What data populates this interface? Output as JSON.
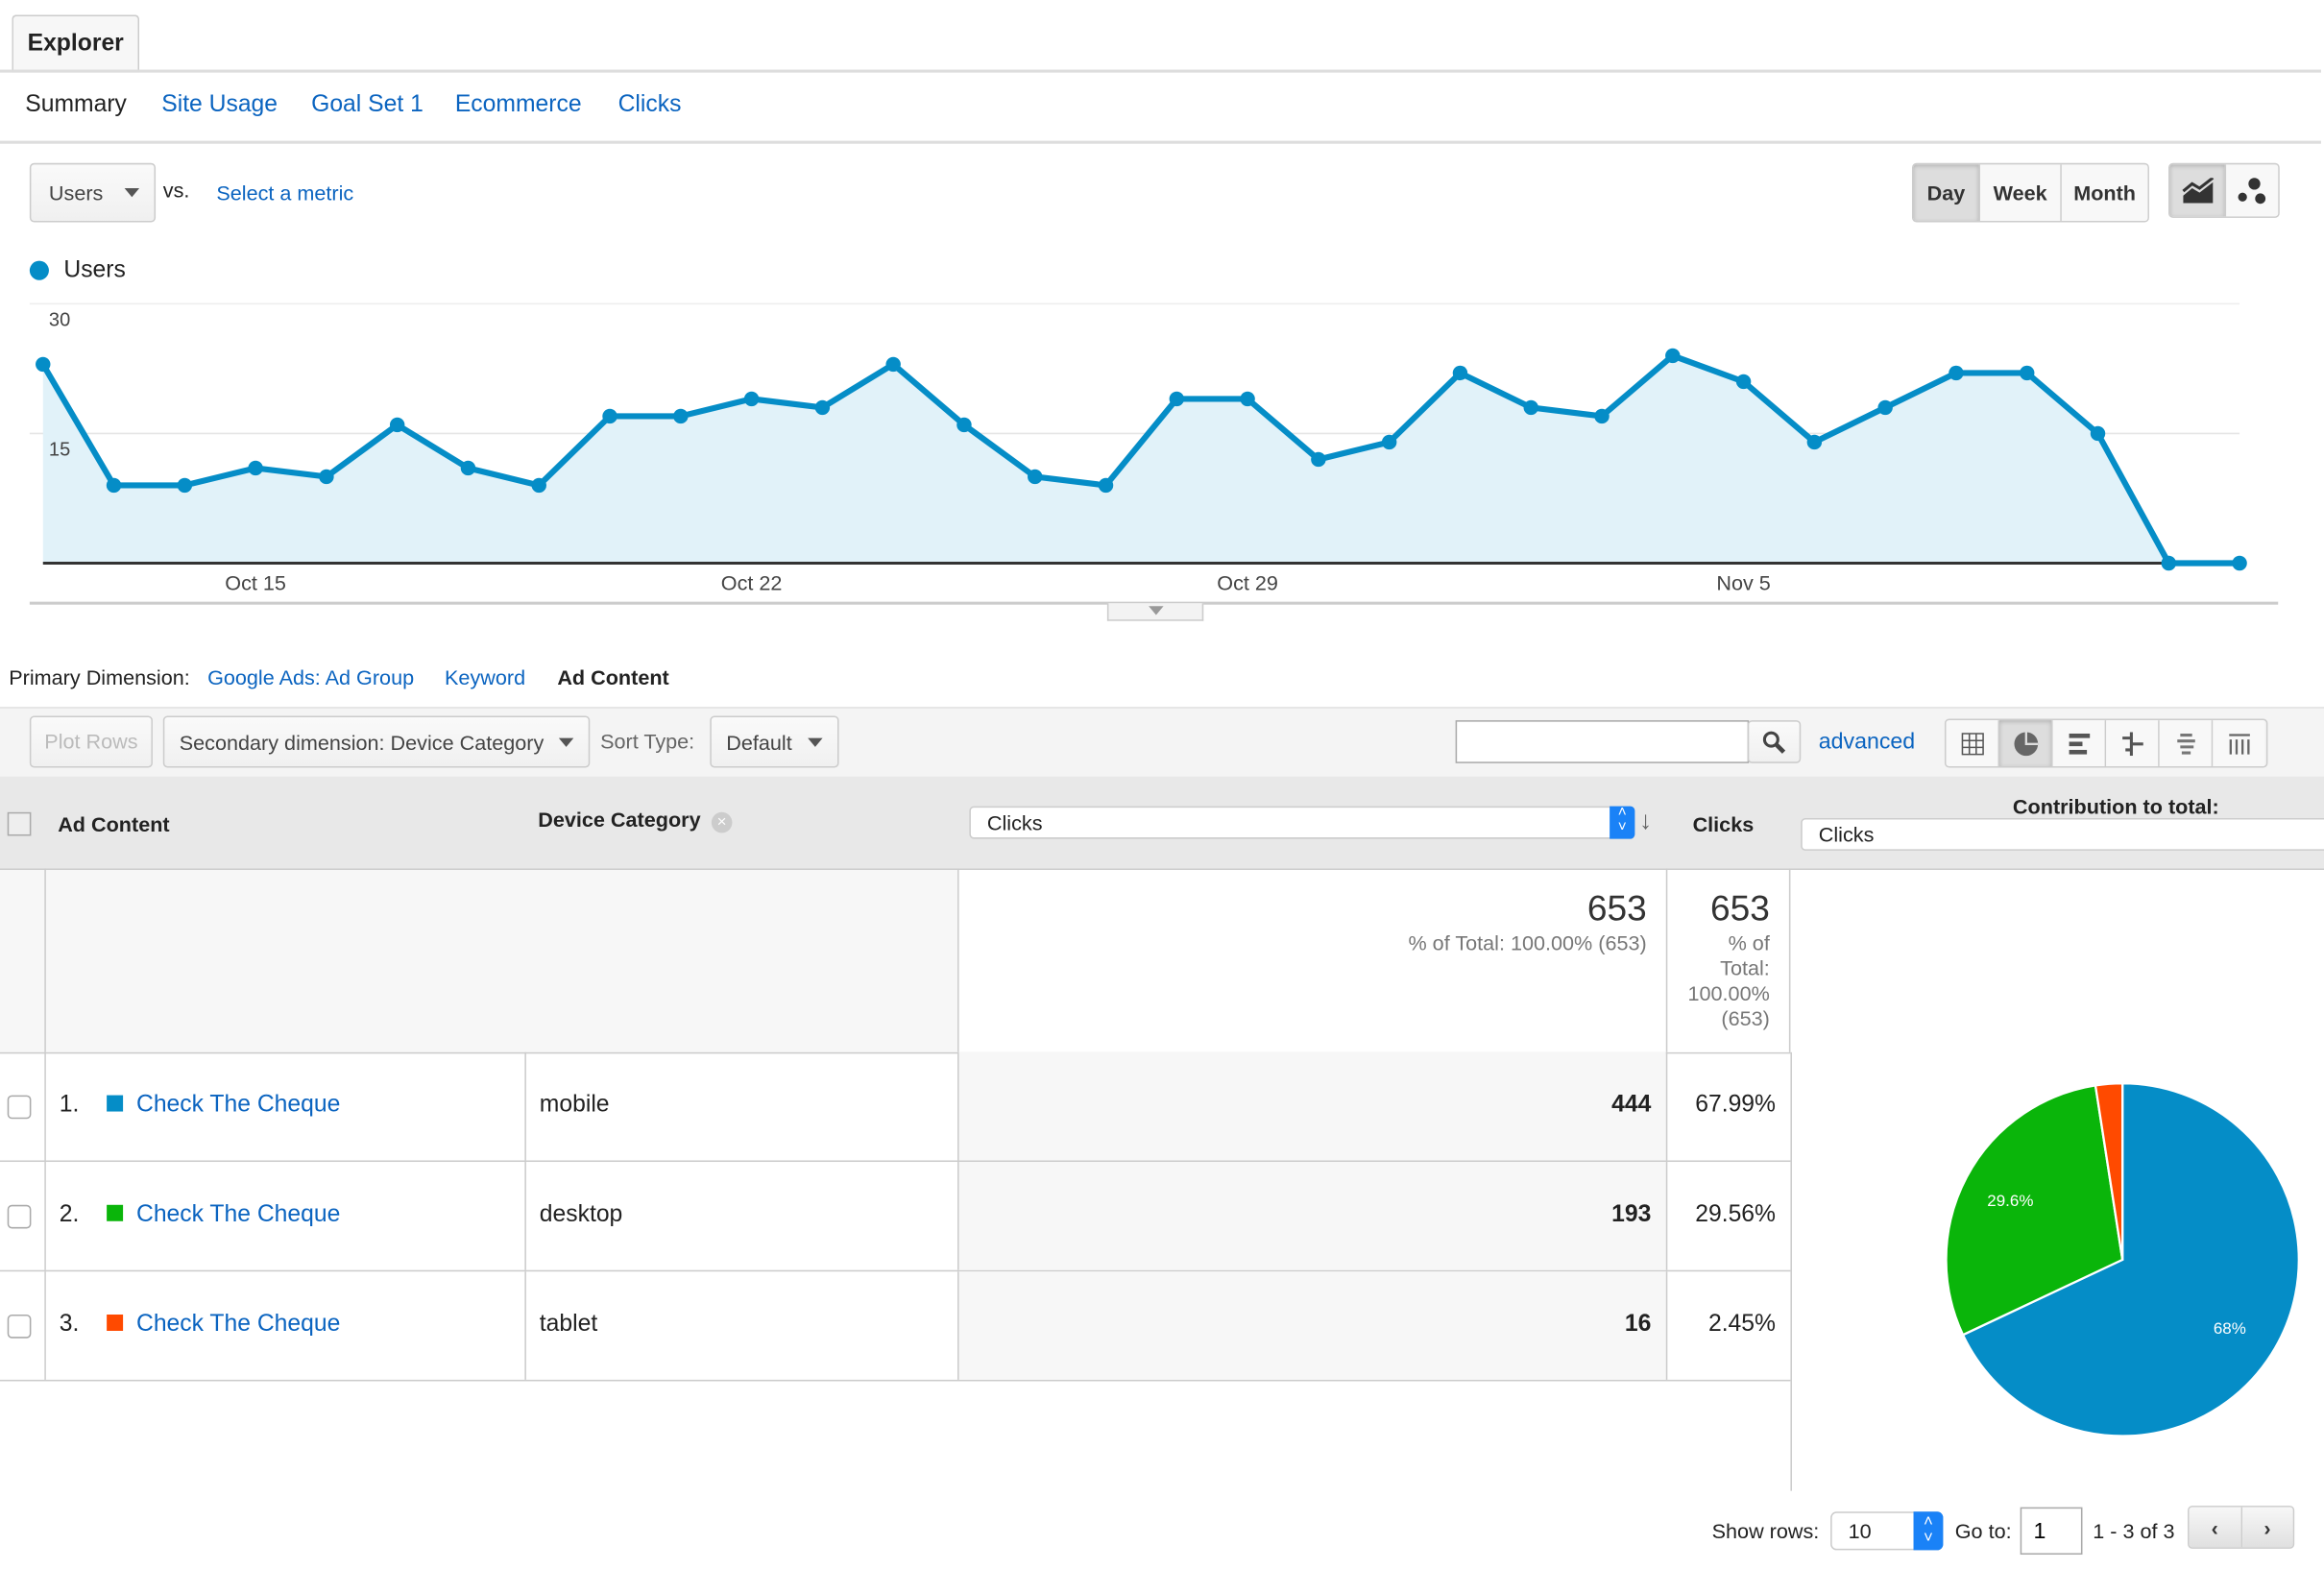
{
  "tabs": {
    "explorer": "Explorer"
  },
  "subtabs": [
    {
      "label": "Summary",
      "active": true
    },
    {
      "label": "Site Usage"
    },
    {
      "label": "Goal Set 1"
    },
    {
      "label": "Ecommerce"
    },
    {
      "label": "Clicks"
    }
  ],
  "metric": {
    "selected": "Users",
    "vs": "vs.",
    "select_link": "Select a metric"
  },
  "granularity": {
    "options": [
      "Day",
      "Week",
      "Month"
    ],
    "selected": "Day"
  },
  "chart_mode": {
    "options": [
      "line-chart-icon",
      "motion-chart-icon"
    ],
    "selected": "line-chart-icon"
  },
  "chart_data": {
    "type": "area",
    "series": [
      {
        "name": "Users",
        "color": "#058dc7",
        "values": [
          23,
          9,
          9,
          11,
          10,
          16,
          11,
          9,
          17,
          17,
          19,
          18,
          23,
          16,
          10,
          9,
          19,
          19,
          12,
          14,
          22,
          18,
          17,
          24,
          21,
          14,
          18,
          22,
          22,
          15,
          0,
          0
        ]
      }
    ],
    "x_start": "Oct 12",
    "x_end": "Nov 12",
    "xtick_labels": [
      {
        "index": 3,
        "label": "Oct 15"
      },
      {
        "index": 10,
        "label": "Oct 22"
      },
      {
        "index": 17,
        "label": "Oct 29"
      },
      {
        "index": 24,
        "label": "Nov 5"
      }
    ],
    "ytick_labels": [
      "30",
      "15"
    ],
    "ylim": [
      0,
      30
    ],
    "grid": true,
    "legend": "top-left"
  },
  "dimension": {
    "label": "Primary Dimension:",
    "options": [
      "Google Ads: Ad Group",
      "Keyword",
      "Ad Content"
    ],
    "selected": "Ad Content"
  },
  "toolbar": {
    "plot_rows": "Plot Rows",
    "secondary": "Secondary dimension: Device Category",
    "sort_label": "Sort Type:",
    "sort_value": "Default",
    "search_value": "",
    "advanced": "advanced"
  },
  "table": {
    "headers": {
      "ad_content": "Ad Content",
      "device": "Device Category",
      "metric_select": "Clicks",
      "clicks": "Clicks",
      "contribution": "Contribution to total:",
      "contribution_select": "Clicks"
    },
    "totals": {
      "value": "653",
      "pct_text": "% of Total: 100.00% (653)",
      "value2": "653",
      "pct_lines": [
        "% of",
        "Total:",
        "100.00%",
        "(653)"
      ]
    },
    "rows": [
      {
        "num": "1.",
        "ad": "Check The Cheque",
        "device": "mobile",
        "clicks": "444",
        "pct": "67.99%",
        "color": "#058dc7"
      },
      {
        "num": "2.",
        "ad": "Check The Cheque",
        "device": "desktop",
        "clicks": "193",
        "pct": "29.56%",
        "color": "#0ab50a"
      },
      {
        "num": "3.",
        "ad": "Check The Cheque",
        "device": "tablet",
        "clicks": "16",
        "pct": "2.45%",
        "color": "#ff4a00"
      }
    ]
  },
  "pie": {
    "values": [
      444,
      193,
      16
    ],
    "colors": [
      "#058dc7",
      "#0ab50a",
      "#ff4a00"
    ],
    "labels": [
      "68%",
      "29.6%",
      ""
    ]
  },
  "footer": {
    "show_rows_label": "Show rows:",
    "show_rows": "10",
    "goto_label": "Go to:",
    "goto": "1",
    "range": "1 - 3 of 3"
  }
}
